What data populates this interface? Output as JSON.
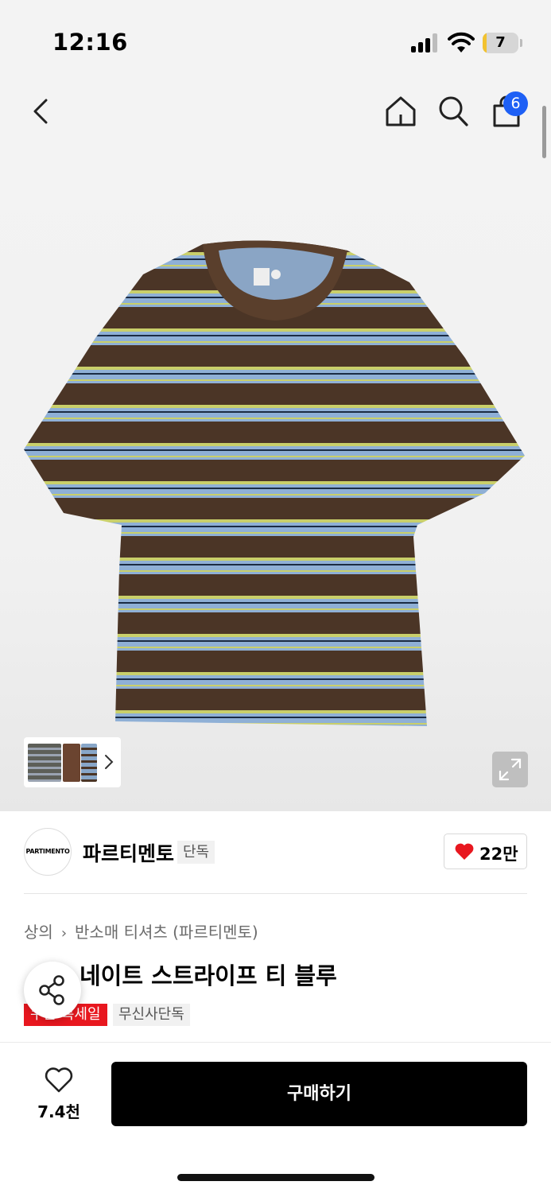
{
  "status_bar": {
    "time": "12:16",
    "battery_level": "7",
    "battery_fraction": 0.07
  },
  "nav": {
    "cart_count": "6"
  },
  "colors": {
    "accent_blue": "#1e60f5",
    "sale_red": "#e8171f",
    "heart_red": "#e8171f",
    "stripe_brown": "#4b3526",
    "stripe_blue": "#8fb0d6",
    "stripe_lime": "#c9cf6a"
  },
  "brand": {
    "logo_text": "PARTIMENTO",
    "name": "파르티멘토",
    "tag": "단독",
    "likes": "22만"
  },
  "product": {
    "breadcrumb": [
      "상의",
      "반소매 티셔츠 (파르티멘토)"
    ],
    "title": "오버사이즈 스트라이프 티 블루",
    "title_visible": "네이트 스트라이프 티 블루",
    "tags": {
      "sale": "블랙프라이데이 특세일",
      "sale_visible": "쿠폰 특세일",
      "exclusive": "무신사단독"
    }
  },
  "bottom_bar": {
    "wishlist_count": "7.4천",
    "buy_label": "구매하기"
  },
  "icons": [
    "back-icon",
    "home-icon",
    "search-icon",
    "bag-icon",
    "expand-icon",
    "heart-icon",
    "share-icon",
    "chevron-right-icon"
  ]
}
